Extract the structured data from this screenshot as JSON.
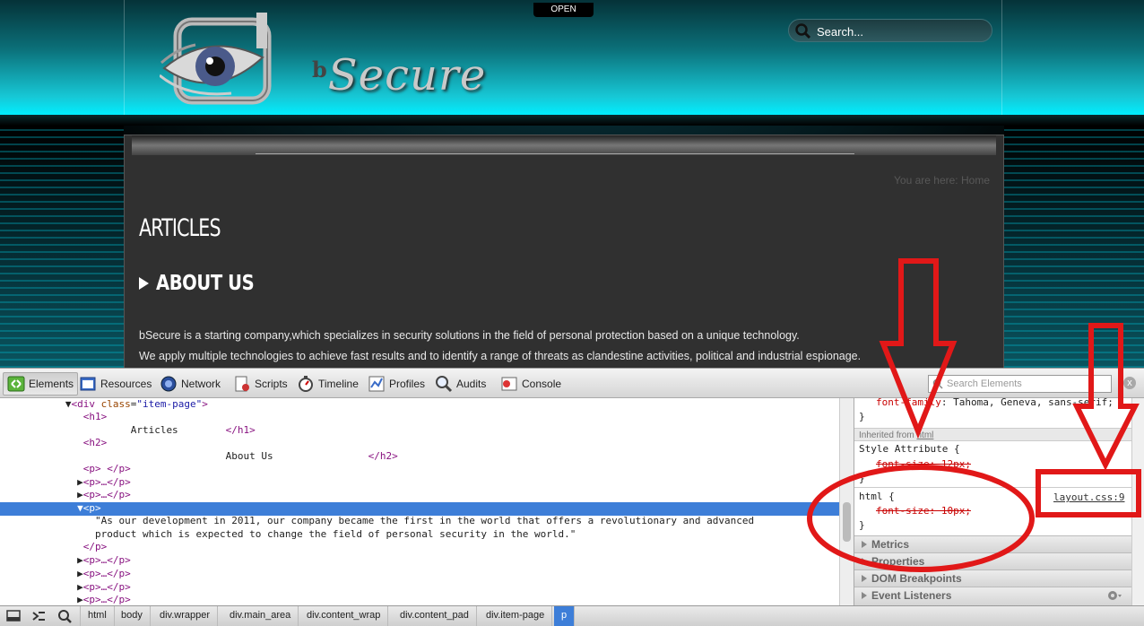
{
  "site": {
    "open_tab": "OPEN",
    "brand_prefix": "b",
    "brand_name": "Secure",
    "search_placeholder": "Search...",
    "breadcrumb": "You are here:  Home",
    "heading_articles": "ARTICLES",
    "heading_about": "ABOUT US",
    "paragraph_1": "bSecure is a starting company,which specializes in security solutions in the field of personal protection based on a unique technology.",
    "paragraph_2": "We apply multiple technologies to achieve fast results and to identify a range of threats as clandestine activities, political and industrial espionage."
  },
  "devtools": {
    "tabs": [
      {
        "label": "Elements",
        "active": true
      },
      {
        "label": "Resources"
      },
      {
        "label": "Network"
      },
      {
        "label": "Scripts"
      },
      {
        "label": "Timeline"
      },
      {
        "label": "Profiles"
      },
      {
        "label": "Audits"
      },
      {
        "label": "Console"
      }
    ],
    "search_placeholder": "Search Elements",
    "close_label": "x",
    "dom": {
      "l0_open": "<div",
      "l0_attr": "class",
      "l0_val": "\"item-page\"",
      "l0_close": ">",
      "l1_tag": "<h1>",
      "l2_text": "Articles",
      "l2_close": "</h1>",
      "l3_tag": "<h2>",
      "l4_text": "About Us",
      "l4_close": "</h2>",
      "l5": "<p> </p>",
      "l6": "<p>…</p>",
      "l7": "<p>…</p>",
      "l8": "<p>",
      "l9": "\"As our development in 2011, our company became the first in the world that offers a revolutionary and advanced",
      "l10": "product which is expected to change the field of personal security in the world.\"",
      "l11": "</p>",
      "l12": "<p>…</p>",
      "l13": "<p>…</p>",
      "l14": "<p>…</p>",
      "l15": "<p>…</p>"
    },
    "styles": {
      "font_family_prop": "font-family",
      "font_family_val": "Tahoma, Geneva, sans-serif;",
      "close_brace": "}",
      "inherited_prefix": "Inherited from ",
      "inherited_from": "html",
      "style_attr_header": "Style Attribute {",
      "style_attr_prop": "font-size: 12px;",
      "html_rule": "html {",
      "html_prop": "font-size: 10px;",
      "css_link": "layout.css:9"
    },
    "panes": [
      "Metrics",
      "Properties",
      "DOM Breakpoints",
      "Event Listeners"
    ],
    "breadcrumbs": [
      "html",
      "body",
      "div.wrapper",
      "div.main_area",
      "div.content_wrap",
      "div.content_pad",
      "div.item-page",
      "p"
    ],
    "colors": {
      "selection": "#3d7ed8",
      "annotation": "#e11818"
    }
  }
}
